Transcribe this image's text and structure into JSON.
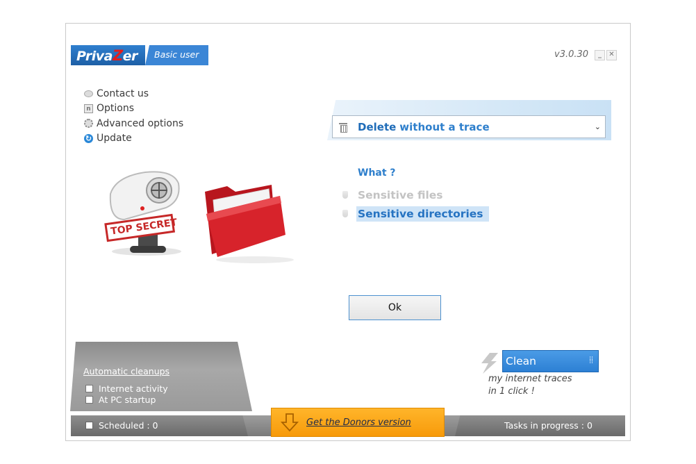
{
  "titlebar": {
    "logo_part1": "Priva",
    "logo_z": "Z",
    "logo_part2": "er",
    "user_mode": "Basic user",
    "version": "v3.0.30",
    "minimize_glyph": "_",
    "close_glyph": "✕"
  },
  "menu": {
    "items": [
      {
        "label": "Contact us",
        "icon": "chat-icon"
      },
      {
        "label": "Options",
        "icon": "options-icon",
        "glyph": "n"
      },
      {
        "label": "Advanced options",
        "icon": "gear-icon"
      },
      {
        "label": "Update",
        "icon": "update-icon"
      }
    ]
  },
  "illustration": {
    "stamp_text": "TOP SECRET"
  },
  "action": {
    "selected_part1": "Delete",
    "selected_part2": "without a trace",
    "caret": "⌄"
  },
  "what": {
    "heading": "What ?",
    "options": [
      {
        "label": "Sensitive files",
        "state": "disabled"
      },
      {
        "label": "Sensitive directories",
        "state": "selected"
      }
    ]
  },
  "ok_label": "Ok",
  "auto_cleanups": {
    "title": "Automatic cleanups",
    "options": [
      {
        "label": "Internet activity",
        "checked": false
      },
      {
        "label": "At PC startup",
        "checked": false
      }
    ]
  },
  "clean": {
    "label": "Clean",
    "line1": "my internet traces",
    "line2": "in 1 click !"
  },
  "bottom": {
    "scheduled": "Scheduled : 0",
    "donors": "Get the Donors version",
    "tasks": "Tasks in progress : 0"
  },
  "colors": {
    "accent_blue": "#2e7fcc",
    "donors_orange": "#f79a0a",
    "folder_red": "#d7232b",
    "panel_gray": "#9a9a9a"
  }
}
